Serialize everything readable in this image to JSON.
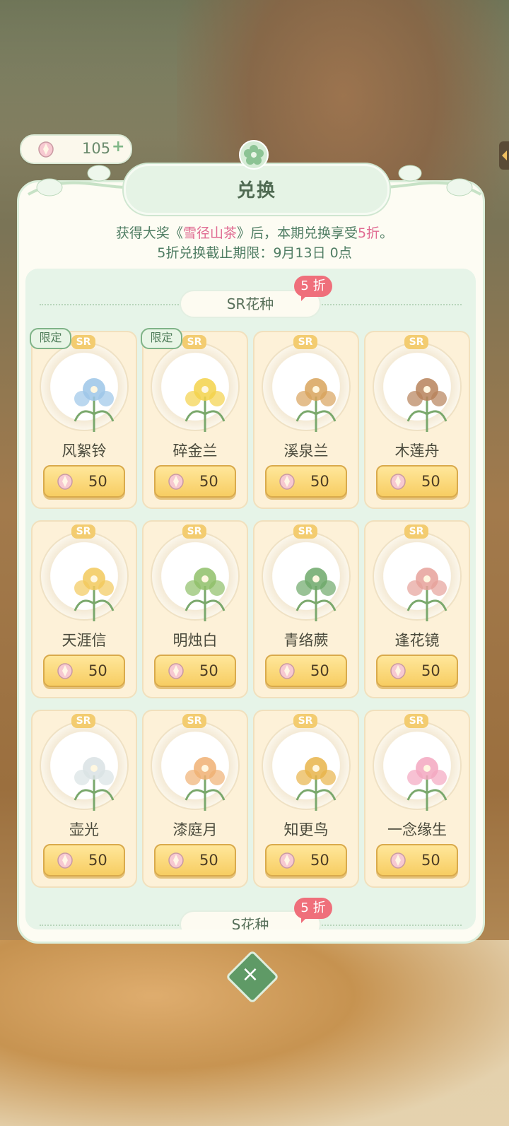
{
  "currency": {
    "value": "105",
    "plus": "+"
  },
  "title": "兑换",
  "info": {
    "line1_prefix": "获得大奖《",
    "line1_prize": "雪径山茶",
    "line1_mid": "》后，本期兑换享受",
    "line1_discount": "5折",
    "line1_suffix": "。",
    "line2": "5折兑换截止期限：9月13日 0点"
  },
  "sections": [
    {
      "name": "SR花种",
      "discount": "5 折"
    },
    {
      "name": "S花种",
      "discount": "5 折"
    }
  ],
  "items": [
    {
      "name": "风絮铃",
      "price": "50",
      "badge": "SR",
      "limited": "限定",
      "color": "#9cc6e8"
    },
    {
      "name": "碎金兰",
      "price": "50",
      "badge": "SR",
      "limited": "限定",
      "color": "#f3d24a"
    },
    {
      "name": "溪泉兰",
      "price": "50",
      "badge": "SR",
      "limited": "",
      "color": "#d8a35c"
    },
    {
      "name": "木莲舟",
      "price": "50",
      "badge": "SR",
      "limited": "",
      "color": "#b7825a"
    },
    {
      "name": "天涯信",
      "price": "50",
      "badge": "SR",
      "limited": "",
      "color": "#f2c95c"
    },
    {
      "name": "明烛白",
      "price": "50",
      "badge": "SR",
      "limited": "",
      "color": "#8fbf68"
    },
    {
      "name": "青络蕨",
      "price": "50",
      "badge": "SR",
      "limited": "",
      "color": "#6da86a"
    },
    {
      "name": "逢花镜",
      "price": "50",
      "badge": "SR",
      "limited": "",
      "color": "#e6a19a"
    },
    {
      "name": "壶光",
      "price": "50",
      "badge": "SR",
      "limited": "",
      "color": "#d9e2e4"
    },
    {
      "name": "漆庭月",
      "price": "50",
      "badge": "SR",
      "limited": "",
      "color": "#f0b073"
    },
    {
      "name": "知更鸟",
      "price": "50",
      "badge": "SR",
      "limited": "",
      "color": "#e8b44a"
    },
    {
      "name": "一念缘生",
      "price": "50",
      "badge": "SR",
      "limited": "",
      "color": "#f3a7c0"
    }
  ],
  "close_label": "×"
}
